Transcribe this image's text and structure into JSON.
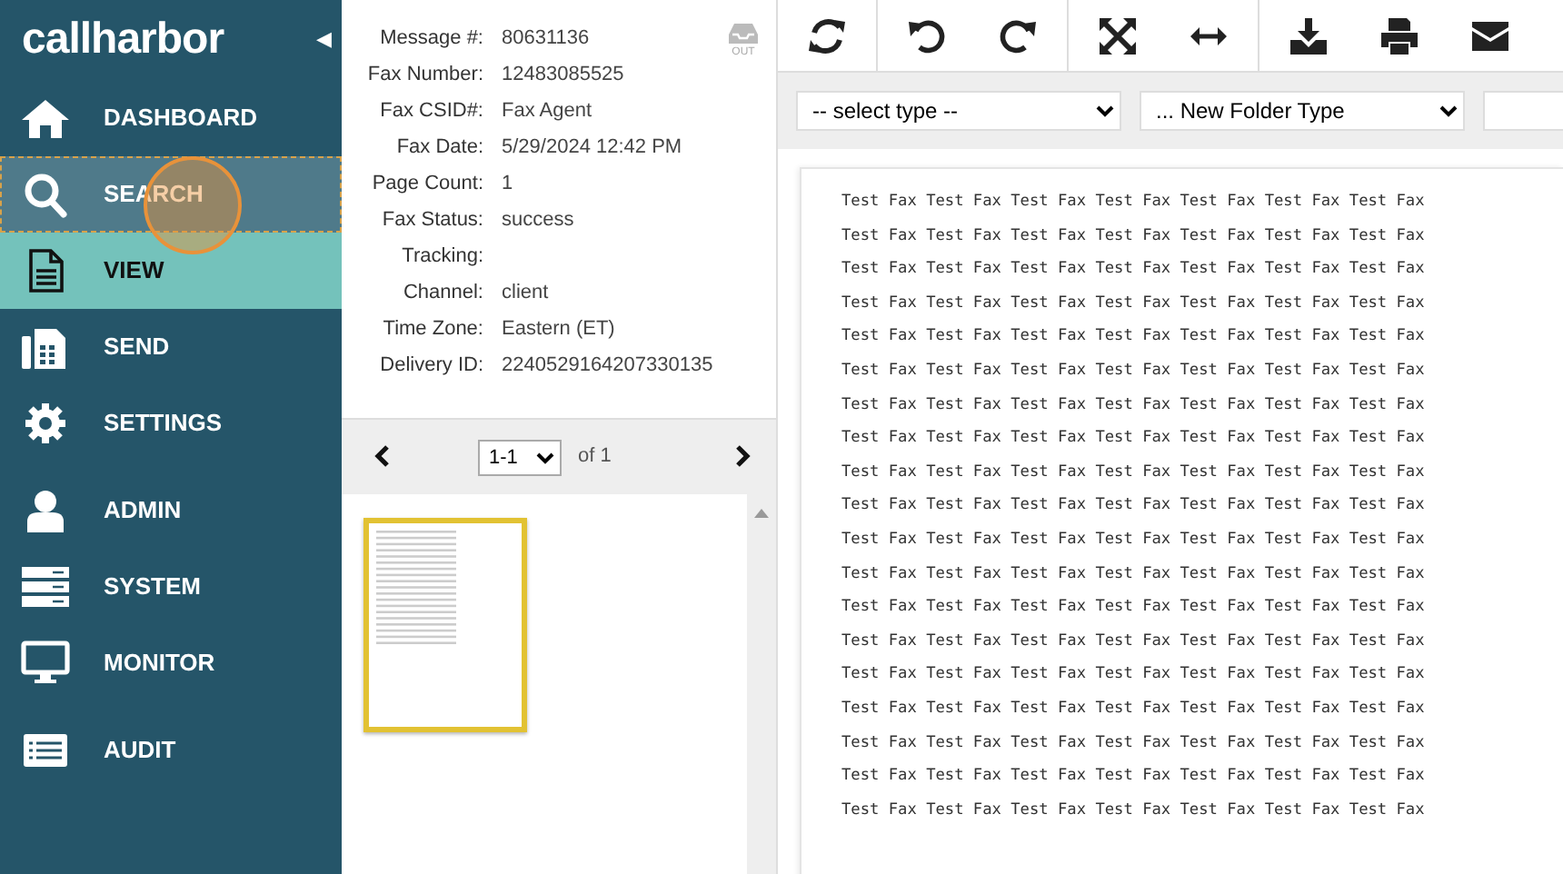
{
  "sidebar": {
    "logo": "callharbor",
    "collapse_glyph": "◀",
    "items": [
      {
        "label": "DASHBOARD",
        "selected": false,
        "focused": false
      },
      {
        "label": "SEARCH",
        "selected": false,
        "focused": true
      },
      {
        "label": "VIEW",
        "selected": true,
        "focused": false
      },
      {
        "label": "SEND",
        "selected": false,
        "focused": false
      },
      {
        "label": "SETTINGS",
        "selected": false,
        "focused": false
      },
      {
        "label": "ADMIN",
        "selected": false,
        "focused": false
      },
      {
        "label": "SYSTEM",
        "selected": false,
        "focused": false
      },
      {
        "label": "MONITOR",
        "selected": false,
        "focused": false
      },
      {
        "label": "AUDIT",
        "selected": false,
        "focused": false
      }
    ]
  },
  "details": {
    "direction_label": "OUT",
    "fields": [
      {
        "label": "Message #:",
        "value": "80631136"
      },
      {
        "label": "Fax Number:",
        "value": "12483085525"
      },
      {
        "label": "Fax CSID#:",
        "value": "Fax Agent"
      },
      {
        "label": "Fax Date:",
        "value": "5/29/2024 12:42 PM"
      },
      {
        "label": "Page Count:",
        "value": "1"
      },
      {
        "label": "Fax Status:",
        "value": "success"
      },
      {
        "label": "Tracking:"
      },
      {
        "label": "Channel:",
        "value": "client"
      },
      {
        "label": "Time Zone:",
        "value": "Eastern (ET)"
      },
      {
        "label": "Delivery ID:",
        "value": "2240529164207330135"
      }
    ]
  },
  "pager": {
    "page_select": "1-1",
    "of_text": "of 1"
  },
  "thumbnails": [
    {
      "kind": "picture",
      "selected": true
    }
  ],
  "filters": [
    {
      "value": "-- select type --"
    },
    {
      "value": "... New Folder Type"
    }
  ],
  "document": {
    "lines": [
      "Test Fax Test Fax Test Fax Test Fax Test Fax Test Fax Test Fax",
      "Test Fax Test Fax Test Fax Test Fax Test Fax Test Fax Test Fax",
      "Test Fax Test Fax Test Fax Test Fax Test Fax Test Fax Test Fax",
      "Test Fax Test Fax Test Fax Test Fax Test Fax Test Fax Test Fax",
      "Test Fax Test Fax Test Fax Test Fax Test Fax Test Fax Test Fax",
      "Test Fax Test Fax Test Fax Test Fax Test Fax Test Fax Test Fax",
      "Test Fax Test Fax Test Fax Test Fax Test Fax Test Fax Test Fax",
      "Test Fax Test Fax Test Fax Test Fax Test Fax Test Fax Test Fax",
      "Test Fax Test Fax Test Fax Test Fax Test Fax Test Fax Test Fax",
      "Test Fax Test Fax Test Fax Test Fax Test Fax Test Fax Test Fax",
      "Test Fax Test Fax Test Fax Test Fax Test Fax Test Fax Test Fax",
      "Test Fax Test Fax Test Fax Test Fax Test Fax Test Fax Test Fax",
      "Test Fax Test Fax Test Fax Test Fax Test Fax Test Fax Test Fax",
      "Test Fax Test Fax Test Fax Test Fax Test Fax Test Fax Test Fax",
      "Test Fax Test Fax Test Fax Test Fax Test Fax Test Fax Test Fax",
      "Test Fax Test Fax Test Fax Test Fax Test Fax Test Fax Test Fax",
      "Test Fax Test Fax Test Fax Test Fax Test Fax Test Fax Test Fax",
      "Test Fax Test Fax Test Fax Test Fax Test Fax Test Fax Test Fax",
      "Test Fax Test Fax Test Fax Test Fax Test Fax Test Fax Test Fax"
    ]
  }
}
